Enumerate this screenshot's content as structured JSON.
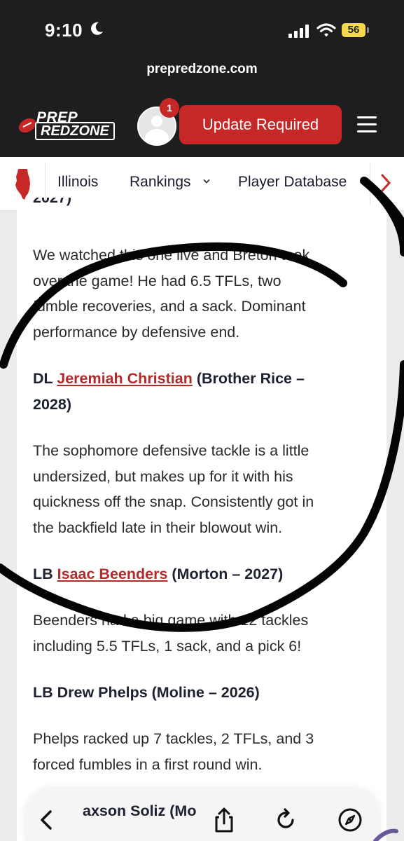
{
  "status_bar": {
    "time": "9:10",
    "battery": "56",
    "icons": [
      "moon-icon",
      "signal-icon",
      "wifi-icon",
      "battery-icon"
    ]
  },
  "browser": {
    "url": "prepredzone.com"
  },
  "site_header": {
    "logo_line1": "PREP",
    "logo_line2": "REDZONE",
    "notification_count": "1",
    "update_button": "Update Required",
    "accent_color": "#c62828"
  },
  "nav": {
    "items": [
      {
        "label": "Illinois"
      },
      {
        "label": "Rankings"
      },
      {
        "label": "Player Database"
      }
    ]
  },
  "article": {
    "cut_top": "2027)",
    "para1": [
      "We watched this one live and Breton took",
      "over the game!  He had 6.5 TFLs, two",
      "fumble recoveries, and a sack.  Dominant",
      "performance by defensive end."
    ],
    "player2": {
      "position": "DL",
      "name": "Jeremiah Christian",
      "detail_line1": "(Brother Rice –",
      "detail_line2": "2028)"
    },
    "para2": [
      "The sophomore defensive tackle is a little",
      "undersized, but makes up for it with his",
      "quickness off the snap.  Consistently got in",
      "the backfield late in their blowout win."
    ],
    "player3": {
      "position": "LB",
      "name": "Isaac Beenders",
      "detail": "(Morton – 2027)"
    },
    "para3": [
      "Beenders had a big game with 12 tackles",
      "including 5.5 TFLs, 1 sack, and a pick 6!"
    ],
    "player4": {
      "heading": "LB Drew Phelps (Moline – 2026)"
    },
    "para4": [
      "Phelps racked up 7 tackles, 2 TFLs, and 3",
      "forced fumbles in a first round win."
    ],
    "player5_partial": "axson Soliz (Mo"
  },
  "toolbar": {
    "buttons": [
      "back-icon",
      "share-icon",
      "reload-icon",
      "compass-icon"
    ]
  }
}
